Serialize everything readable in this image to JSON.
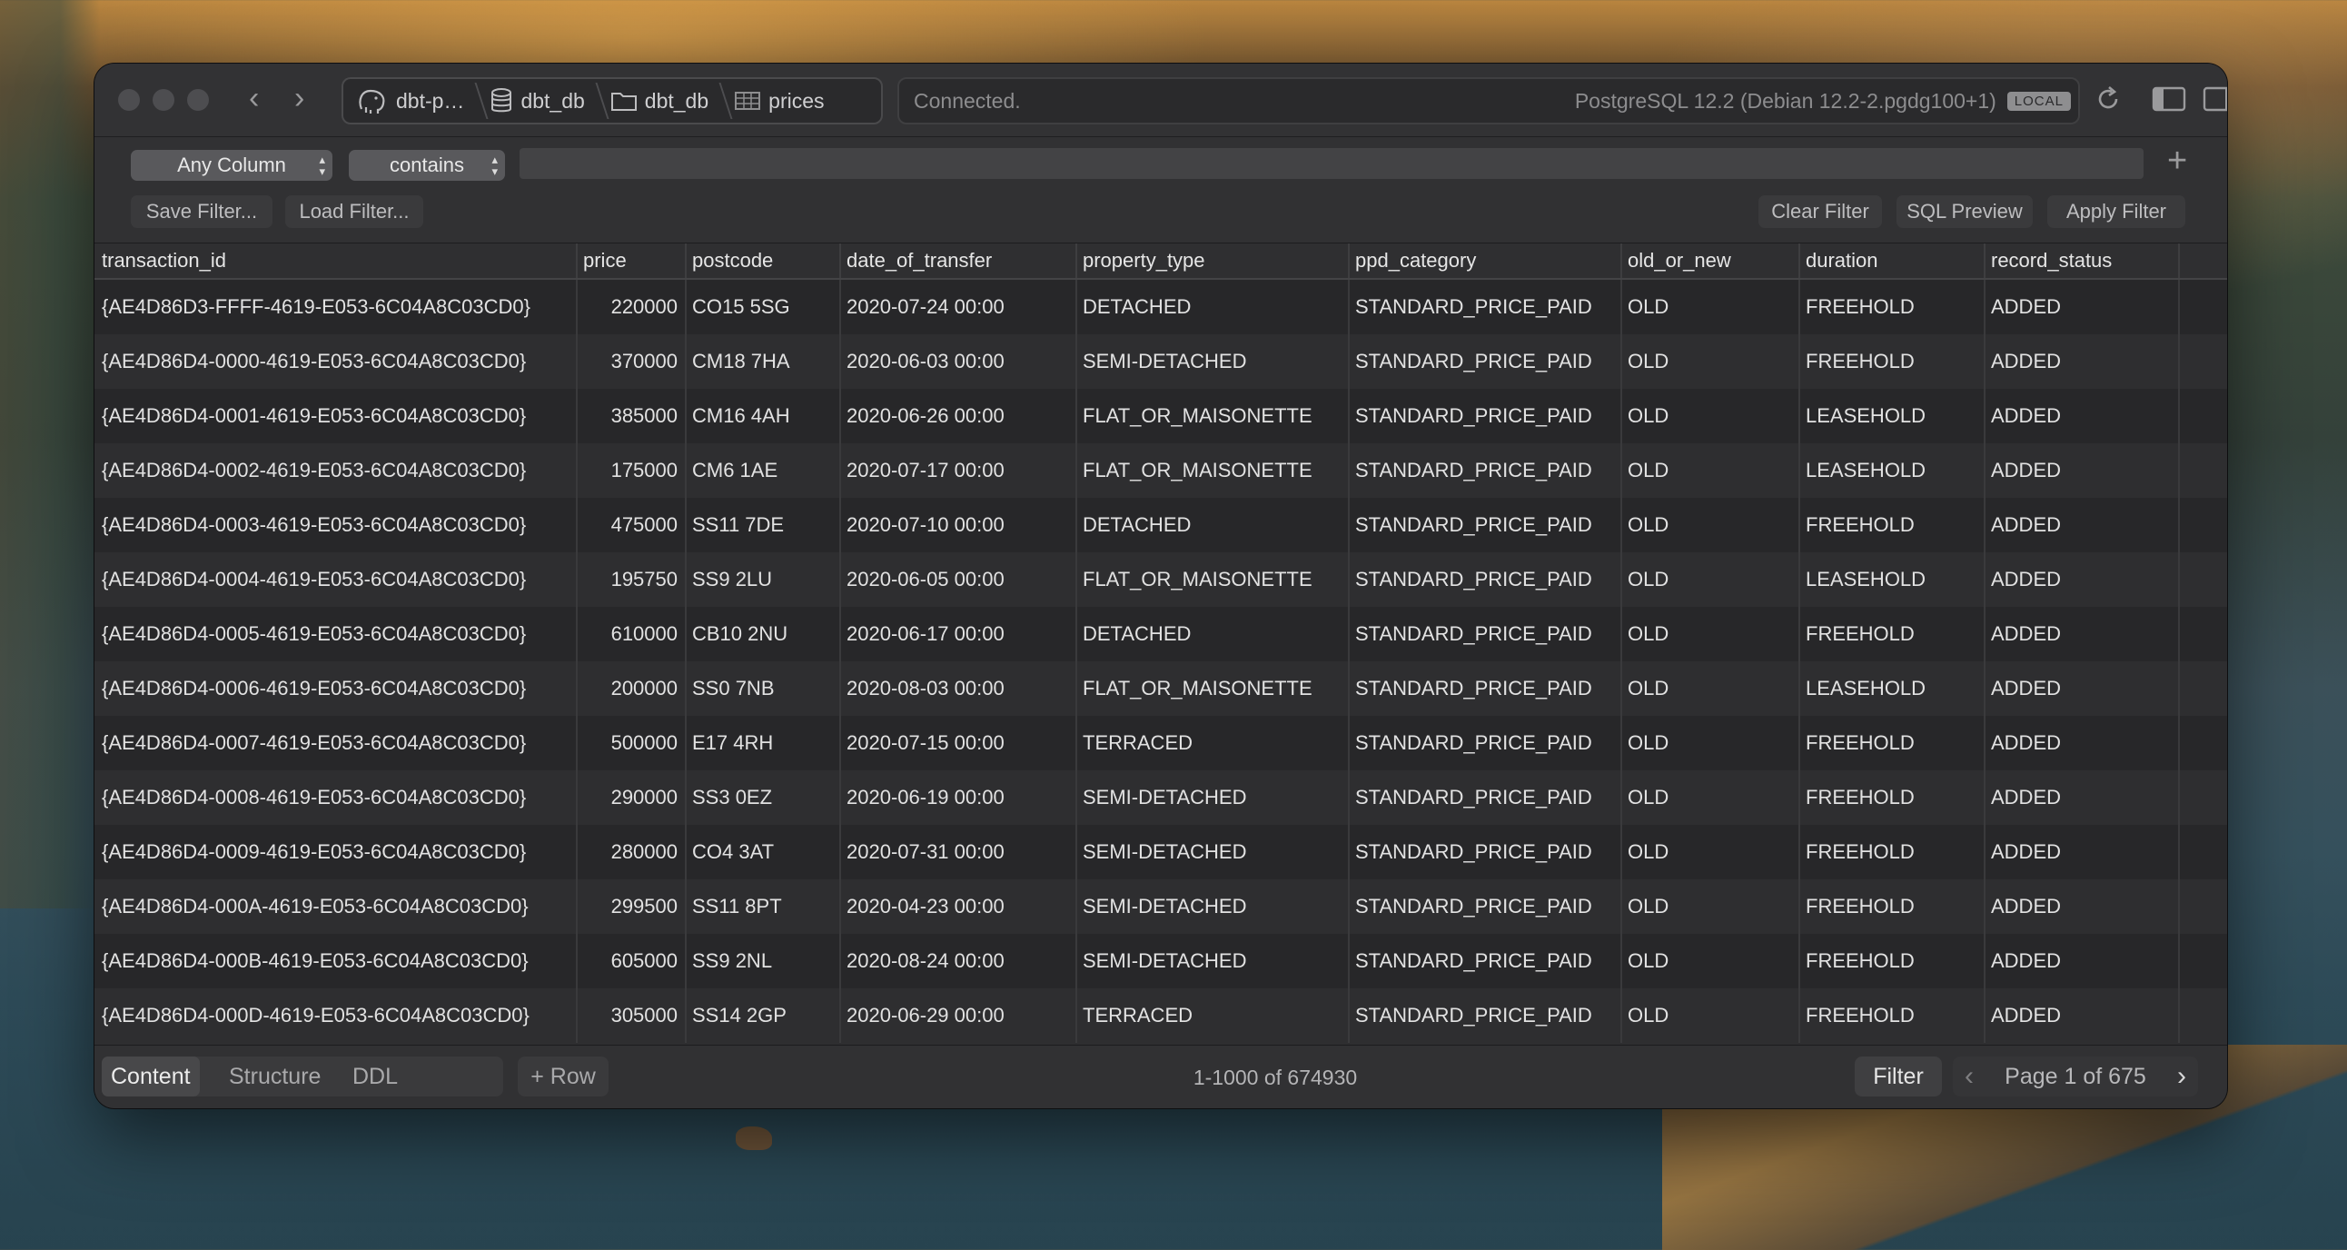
{
  "titlebar": {
    "breadcrumbs": [
      "dbt-p…",
      "dbt_db",
      "dbt_db",
      "prices"
    ],
    "status": "Connected.",
    "server": "PostgreSQL 12.2 (Debian 12.2-2.pgdg100+1)",
    "badge": "LOCAL"
  },
  "filter": {
    "column_select": "Any Column",
    "operator_select": "contains",
    "input_value": "",
    "save_label": "Save Filter...",
    "load_label": "Load Filter...",
    "clear_label": "Clear Filter",
    "preview_label": "SQL Preview",
    "apply_label": "Apply Filter"
  },
  "table": {
    "columns": [
      "transaction_id",
      "price",
      "postcode",
      "date_of_transfer",
      "property_type",
      "ppd_category",
      "old_or_new",
      "duration",
      "record_status"
    ],
    "rows": [
      [
        "{AE4D86D3-FFFF-4619-E053-6C04A8C03CD0}",
        "220000",
        "CO15 5SG",
        "2020-07-24 00:00",
        "DETACHED",
        "STANDARD_PRICE_PAID",
        "OLD",
        "FREEHOLD",
        "ADDED"
      ],
      [
        "{AE4D86D4-0000-4619-E053-6C04A8C03CD0}",
        "370000",
        "CM18 7HA",
        "2020-06-03 00:00",
        "SEMI-DETACHED",
        "STANDARD_PRICE_PAID",
        "OLD",
        "FREEHOLD",
        "ADDED"
      ],
      [
        "{AE4D86D4-0001-4619-E053-6C04A8C03CD0}",
        "385000",
        "CM16 4AH",
        "2020-06-26 00:00",
        "FLAT_OR_MAISONETTE",
        "STANDARD_PRICE_PAID",
        "OLD",
        "LEASEHOLD",
        "ADDED"
      ],
      [
        "{AE4D86D4-0002-4619-E053-6C04A8C03CD0}",
        "175000",
        "CM6 1AE",
        "2020-07-17 00:00",
        "FLAT_OR_MAISONETTE",
        "STANDARD_PRICE_PAID",
        "OLD",
        "LEASEHOLD",
        "ADDED"
      ],
      [
        "{AE4D86D4-0003-4619-E053-6C04A8C03CD0}",
        "475000",
        "SS11 7DE",
        "2020-07-10 00:00",
        "DETACHED",
        "STANDARD_PRICE_PAID",
        "OLD",
        "FREEHOLD",
        "ADDED"
      ],
      [
        "{AE4D86D4-0004-4619-E053-6C04A8C03CD0}",
        "195750",
        "SS9 2LU",
        "2020-06-05 00:00",
        "FLAT_OR_MAISONETTE",
        "STANDARD_PRICE_PAID",
        "OLD",
        "LEASEHOLD",
        "ADDED"
      ],
      [
        "{AE4D86D4-0005-4619-E053-6C04A8C03CD0}",
        "610000",
        "CB10 2NU",
        "2020-06-17 00:00",
        "DETACHED",
        "STANDARD_PRICE_PAID",
        "OLD",
        "FREEHOLD",
        "ADDED"
      ],
      [
        "{AE4D86D4-0006-4619-E053-6C04A8C03CD0}",
        "200000",
        "SS0 7NB",
        "2020-08-03 00:00",
        "FLAT_OR_MAISONETTE",
        "STANDARD_PRICE_PAID",
        "OLD",
        "LEASEHOLD",
        "ADDED"
      ],
      [
        "{AE4D86D4-0007-4619-E053-6C04A8C03CD0}",
        "500000",
        "E17 4RH",
        "2020-07-15 00:00",
        "TERRACED",
        "STANDARD_PRICE_PAID",
        "OLD",
        "FREEHOLD",
        "ADDED"
      ],
      [
        "{AE4D86D4-0008-4619-E053-6C04A8C03CD0}",
        "290000",
        "SS3 0EZ",
        "2020-06-19 00:00",
        "SEMI-DETACHED",
        "STANDARD_PRICE_PAID",
        "OLD",
        "FREEHOLD",
        "ADDED"
      ],
      [
        "{AE4D86D4-0009-4619-E053-6C04A8C03CD0}",
        "280000",
        "CO4 3AT",
        "2020-07-31 00:00",
        "SEMI-DETACHED",
        "STANDARD_PRICE_PAID",
        "OLD",
        "FREEHOLD",
        "ADDED"
      ],
      [
        "{AE4D86D4-000A-4619-E053-6C04A8C03CD0}",
        "299500",
        "SS11 8PT",
        "2020-04-23 00:00",
        "SEMI-DETACHED",
        "STANDARD_PRICE_PAID",
        "OLD",
        "FREEHOLD",
        "ADDED"
      ],
      [
        "{AE4D86D4-000B-4619-E053-6C04A8C03CD0}",
        "605000",
        "SS9 2NL",
        "2020-08-24 00:00",
        "SEMI-DETACHED",
        "STANDARD_PRICE_PAID",
        "OLD",
        "FREEHOLD",
        "ADDED"
      ],
      [
        "{AE4D86D4-000D-4619-E053-6C04A8C03CD0}",
        "305000",
        "SS14 2GP",
        "2020-06-29 00:00",
        "TERRACED",
        "STANDARD_PRICE_PAID",
        "OLD",
        "FREEHOLD",
        "ADDED"
      ]
    ]
  },
  "bottom": {
    "tabs": [
      "Content",
      "Structure",
      "DDL"
    ],
    "add_row": "+ Row",
    "count": "1-1000 of 674930",
    "filter_label": "Filter",
    "page": "Page 1 of 675"
  }
}
